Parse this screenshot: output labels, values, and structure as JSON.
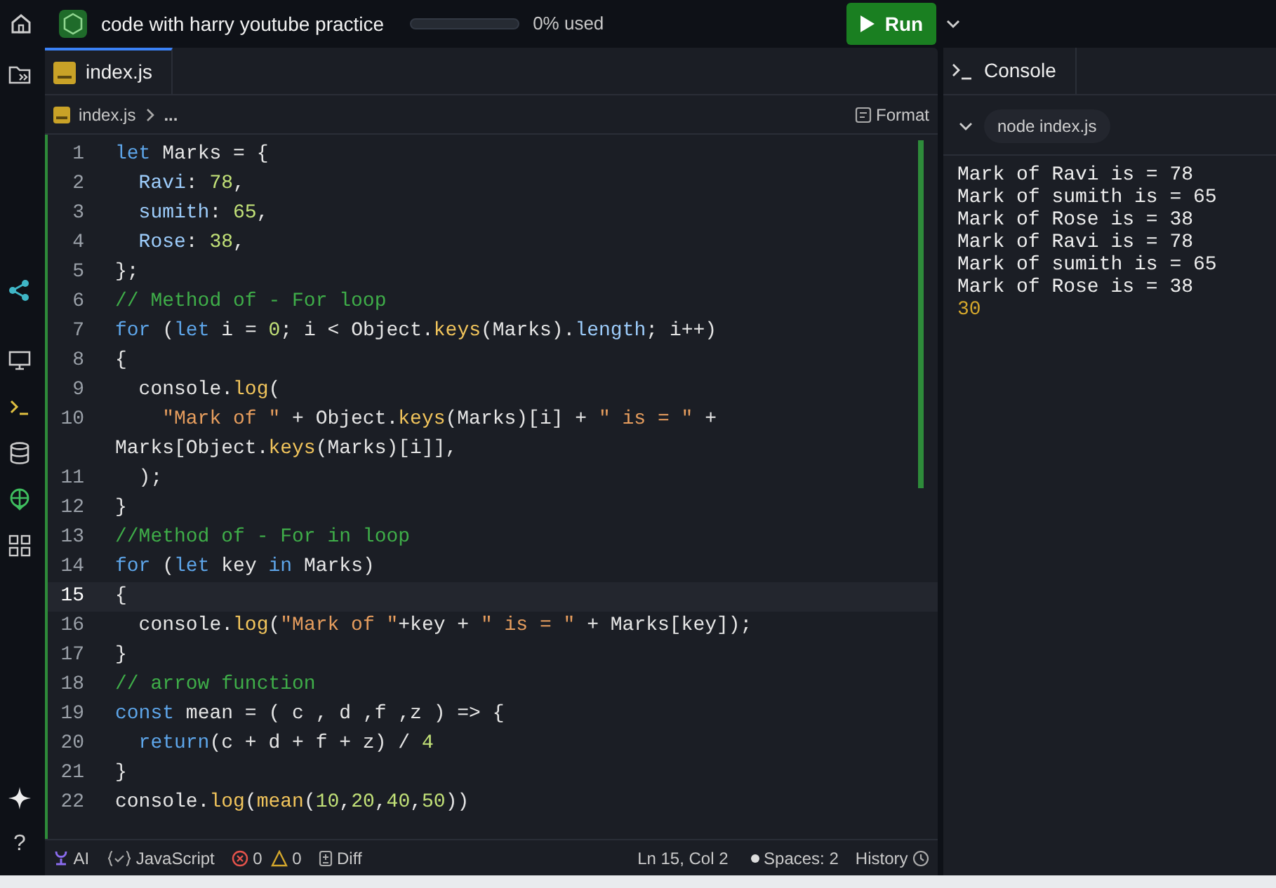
{
  "top_bar": {
    "project_title": "code with harry youtube practice",
    "usage": {
      "level": 0,
      "text": "0% used"
    },
    "run_button": "Run"
  },
  "sidebar": {
    "help": "?"
  },
  "editor": {
    "tab": {
      "label": "index.js",
      "selected": true
    },
    "breadcrumb": [
      "index.js",
      "..."
    ],
    "format_button": "Format",
    "lines": [
      {
        "number": "1",
        "active": false,
        "tokens": [
          {
            "kind": "kw",
            "text": "let"
          },
          {
            "kind": "plain",
            "text": " Marks = {"
          }
        ]
      },
      {
        "number": "2",
        "active": false,
        "tokens": [
          {
            "kind": "prop",
            "text": "  Ravi"
          },
          {
            "kind": "plain",
            "text": ": "
          },
          {
            "kind": "num",
            "text": "78"
          },
          {
            "kind": "plain",
            "text": ","
          }
        ]
      },
      {
        "number": "3",
        "active": false,
        "tokens": [
          {
            "kind": "prop",
            "text": "  sumith"
          },
          {
            "kind": "plain",
            "text": ": "
          },
          {
            "kind": "num",
            "text": "65"
          },
          {
            "kind": "plain",
            "text": ","
          }
        ]
      },
      {
        "number": "4",
        "active": false,
        "tokens": [
          {
            "kind": "prop",
            "text": "  Rose"
          },
          {
            "kind": "plain",
            "text": ": "
          },
          {
            "kind": "num",
            "text": "38"
          },
          {
            "kind": "plain",
            "text": ","
          }
        ]
      },
      {
        "number": "5",
        "active": false,
        "tokens": [
          {
            "kind": "plain",
            "text": "};"
          }
        ]
      },
      {
        "number": "6",
        "active": false,
        "tokens": [
          {
            "kind": "comment",
            "text": "// Method of - For loop"
          }
        ]
      },
      {
        "number": "7",
        "active": false,
        "tokens": [
          {
            "kind": "kw",
            "text": "for"
          },
          {
            "kind": "plain",
            "text": " ("
          },
          {
            "kind": "kw",
            "text": "let"
          },
          {
            "kind": "plain",
            "text": " i = "
          },
          {
            "kind": "num",
            "text": "0"
          },
          {
            "kind": "plain",
            "text": "; i < Object."
          },
          {
            "kind": "fn",
            "text": "keys"
          },
          {
            "kind": "plain",
            "text": "(Marks)."
          },
          {
            "kind": "prop",
            "text": "length"
          },
          {
            "kind": "plain",
            "text": "; i++)"
          }
        ]
      },
      {
        "number": "8",
        "active": false,
        "tokens": [
          {
            "kind": "plain",
            "text": "{"
          }
        ]
      },
      {
        "number": "9",
        "active": false,
        "tokens": [
          {
            "kind": "plain",
            "text": "  console."
          },
          {
            "kind": "fn",
            "text": "log"
          },
          {
            "kind": "plain",
            "text": "("
          }
        ]
      },
      {
        "number": "10",
        "active": false,
        "tokens": [
          {
            "kind": "str",
            "text": "    \"Mark of \""
          },
          {
            "kind": "plain",
            "text": " + Object."
          },
          {
            "kind": "fn",
            "text": "keys"
          },
          {
            "kind": "plain",
            "text": "(Marks)[i] + "
          },
          {
            "kind": "str",
            "text": "\" is = \""
          },
          {
            "kind": "plain",
            "text": " +"
          },
          {
            "kind": "wrapped",
            "text": "Marks[Object."
          },
          {
            "kind": "fn",
            "text": "keys"
          },
          {
            "kind": "plain",
            "text": "(Marks)[i]],"
          }
        ]
      },
      {
        "number": "11",
        "active": false,
        "tokens": [
          {
            "kind": "plain",
            "text": "  );"
          }
        ]
      },
      {
        "number": "12",
        "active": false,
        "tokens": [
          {
            "kind": "plain",
            "text": "}"
          }
        ]
      },
      {
        "number": "13",
        "active": false,
        "tokens": [
          {
            "kind": "comment",
            "text": "//Method of - For in loop"
          }
        ]
      },
      {
        "number": "14",
        "active": false,
        "tokens": [
          {
            "kind": "kw",
            "text": "for"
          },
          {
            "kind": "plain",
            "text": " ("
          },
          {
            "kind": "kw",
            "text": "let"
          },
          {
            "kind": "plain",
            "text": " key "
          },
          {
            "kind": "kw",
            "text": "in"
          },
          {
            "kind": "plain",
            "text": " Marks)"
          }
        ]
      },
      {
        "number": "15",
        "active": true,
        "tokens": [
          {
            "kind": "plain",
            "text": "{"
          }
        ]
      },
      {
        "number": "16",
        "active": false,
        "tokens": [
          {
            "kind": "plain",
            "text": "  console."
          },
          {
            "kind": "fn",
            "text": "log"
          },
          {
            "kind": "plain",
            "text": "("
          },
          {
            "kind": "str",
            "text": "\"Mark of \""
          },
          {
            "kind": "plain",
            "text": "+key + "
          },
          {
            "kind": "str",
            "text": "\" is = \""
          },
          {
            "kind": "plain",
            "text": " + Marks[key]);"
          }
        ]
      },
      {
        "number": "17",
        "active": false,
        "tokens": [
          {
            "kind": "plain",
            "text": "}"
          }
        ]
      },
      {
        "number": "18",
        "active": false,
        "tokens": [
          {
            "kind": "comment",
            "text": "// arrow function"
          }
        ]
      },
      {
        "number": "19",
        "active": false,
        "tokens": [
          {
            "kind": "kw",
            "text": "const"
          },
          {
            "kind": "plain",
            "text": " mean = ( c , d ,f ,z ) => {"
          }
        ]
      },
      {
        "number": "20",
        "active": false,
        "tokens": [
          {
            "kind": "kw",
            "text": "  return"
          },
          {
            "kind": "plain",
            "text": "(c + d + f + z) / "
          },
          {
            "kind": "num",
            "text": "4"
          }
        ]
      },
      {
        "number": "21",
        "active": false,
        "tokens": [
          {
            "kind": "plain",
            "text": "}"
          }
        ]
      },
      {
        "number": "22",
        "active": false,
        "tokens": [
          {
            "kind": "plain",
            "text": "console."
          },
          {
            "kind": "fn",
            "text": "log"
          },
          {
            "kind": "plain",
            "text": "("
          },
          {
            "kind": "fn",
            "text": "mean"
          },
          {
            "kind": "plain",
            "text": "("
          },
          {
            "kind": "num",
            "text": "10"
          },
          {
            "kind": "plain",
            "text": ","
          },
          {
            "kind": "num",
            "text": "20"
          },
          {
            "kind": "plain",
            "text": ","
          },
          {
            "kind": "num",
            "text": "40"
          },
          {
            "kind": "plain",
            "text": ","
          },
          {
            "kind": "num",
            "text": "50"
          },
          {
            "kind": "plain",
            "text": "))"
          }
        ]
      }
    ],
    "status_bar": {
      "ai": "AI",
      "language": "JavaScript",
      "errors": "0",
      "warnings": "0",
      "diff": "Diff",
      "cursor": "Ln 15, Col 2",
      "spaces": "Spaces: 2",
      "history": "History"
    }
  },
  "console": {
    "tab": {
      "label": "Console",
      "selected": true
    },
    "command": "node index.js",
    "output": [
      {
        "kind": "log",
        "text": "Mark of Ravi is = 78"
      },
      {
        "kind": "log",
        "text": "Mark of sumith is = 65"
      },
      {
        "kind": "log",
        "text": "Mark of Rose is = 38"
      },
      {
        "kind": "log",
        "text": "Mark of Ravi is = 78"
      },
      {
        "kind": "log",
        "text": "Mark of sumith is = 65"
      },
      {
        "kind": "log",
        "text": "Mark of Rose is = 38"
      },
      {
        "kind": "value",
        "text": "30"
      }
    ]
  }
}
